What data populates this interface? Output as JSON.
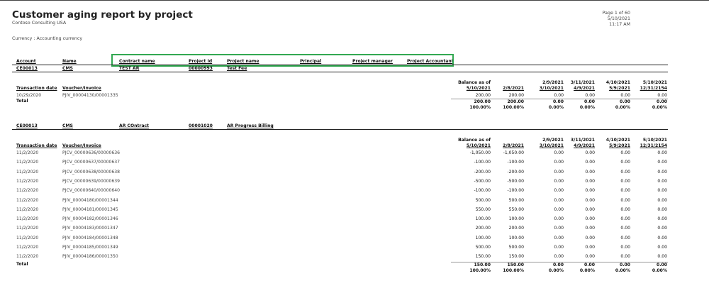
{
  "report": {
    "title": "Customer aging report by project",
    "company": "Contoso Consulting USA",
    "currency": "Currency : Accounting currency",
    "page": "Page 1 of 60",
    "date": "5/10/2021",
    "time": "11:17 AM"
  },
  "columns": {
    "account": "Account",
    "name": "Name",
    "contract_name": "Contract name",
    "project_id": "Project Id",
    "project_name": "Project name",
    "principal": "Principal",
    "project_manager": "Project manager",
    "project_accountant": "Project Accountant"
  },
  "aging_headers": {
    "transaction_date": "Transaction date",
    "voucher_invoice": "Voucher/Invoice",
    "buckets": [
      {
        "line1": "Balance as of",
        "line2": "5/10/2021"
      },
      {
        "line1": "",
        "line2": "2/8/2021"
      },
      {
        "line1": "2/9/2021",
        "line2": "3/10/2021"
      },
      {
        "line1": "3/11/2021",
        "line2": "4/9/2021"
      },
      {
        "line1": "4/10/2021",
        "line2": "5/9/2021"
      },
      {
        "line1": "5/10/2021",
        "line2": "12/31/2154"
      }
    ]
  },
  "groups": [
    {
      "account": "CE00013",
      "name": "CMS",
      "contract_name": "TEST AR",
      "project_id": "00000993",
      "project_name": "Test Fee",
      "rows": [
        {
          "date": "10/29/2020",
          "voucher": "PJIV_00004130/00001335",
          "values": [
            "200.00",
            "200.00",
            "0.00",
            "0.00",
            "0.00",
            "0.00"
          ]
        }
      ],
      "total_label": "Total",
      "totals": [
        "200.00",
        "200.00",
        "0.00",
        "0.00",
        "0.00",
        "0.00"
      ],
      "percents": [
        "100.00%",
        "100.00%",
        "0.00%",
        "0.00%",
        "0.00%",
        "0.00%"
      ]
    },
    {
      "account": "CE00013",
      "name": "CMS",
      "contract_name": "AR COntract",
      "project_id": "00001020",
      "project_name": "AR Progress Billing",
      "rows": [
        {
          "date": "11/2/2020",
          "voucher": "PJCV_00000636/00000636",
          "values": [
            "-1,050.00",
            "-1,050.00",
            "0.00",
            "0.00",
            "0.00",
            "0.00"
          ]
        },
        {
          "date": "11/2/2020",
          "voucher": "PJCV_00000637/00000637",
          "values": [
            "-100.00",
            "-100.00",
            "0.00",
            "0.00",
            "0.00",
            "0.00"
          ]
        },
        {
          "date": "11/2/2020",
          "voucher": "PJCV_00000638/00000638",
          "values": [
            "-200.00",
            "-200.00",
            "0.00",
            "0.00",
            "0.00",
            "0.00"
          ]
        },
        {
          "date": "11/2/2020",
          "voucher": "PJCV_00000639/00000639",
          "values": [
            "-500.00",
            "-500.00",
            "0.00",
            "0.00",
            "0.00",
            "0.00"
          ]
        },
        {
          "date": "11/2/2020",
          "voucher": "PJCV_00000640/00000640",
          "values": [
            "-100.00",
            "-100.00",
            "0.00",
            "0.00",
            "0.00",
            "0.00"
          ]
        },
        {
          "date": "11/2/2020",
          "voucher": "PJIV_00004180/00001344",
          "values": [
            "500.00",
            "500.00",
            "0.00",
            "0.00",
            "0.00",
            "0.00"
          ]
        },
        {
          "date": "11/2/2020",
          "voucher": "PJIV_00004181/00001345",
          "values": [
            "550.00",
            "550.00",
            "0.00",
            "0.00",
            "0.00",
            "0.00"
          ]
        },
        {
          "date": "11/2/2020",
          "voucher": "PJIV_00004182/00001346",
          "values": [
            "100.00",
            "100.00",
            "0.00",
            "0.00",
            "0.00",
            "0.00"
          ]
        },
        {
          "date": "11/2/2020",
          "voucher": "PJIV_00004183/00001347",
          "values": [
            "200.00",
            "200.00",
            "0.00",
            "0.00",
            "0.00",
            "0.00"
          ]
        },
        {
          "date": "11/2/2020",
          "voucher": "PJIV_00004184/00001348",
          "values": [
            "100.00",
            "100.00",
            "0.00",
            "0.00",
            "0.00",
            "0.00"
          ]
        },
        {
          "date": "11/2/2020",
          "voucher": "PJIV_00004185/00001349",
          "values": [
            "500.00",
            "500.00",
            "0.00",
            "0.00",
            "0.00",
            "0.00"
          ]
        },
        {
          "date": "11/2/2020",
          "voucher": "PJIV_00004186/00001350",
          "values": [
            "150.00",
            "150.00",
            "0.00",
            "0.00",
            "0.00",
            "0.00"
          ]
        }
      ],
      "total_label": "Total",
      "totals": [
        "150.00",
        "150.00",
        "0.00",
        "0.00",
        "0.00",
        "0.00"
      ],
      "percents": [
        "100.00%",
        "100.00%",
        "0.00%",
        "0.00%",
        "0.00%",
        "0.00%"
      ]
    }
  ],
  "colors": {
    "highlight": "#33a852"
  }
}
